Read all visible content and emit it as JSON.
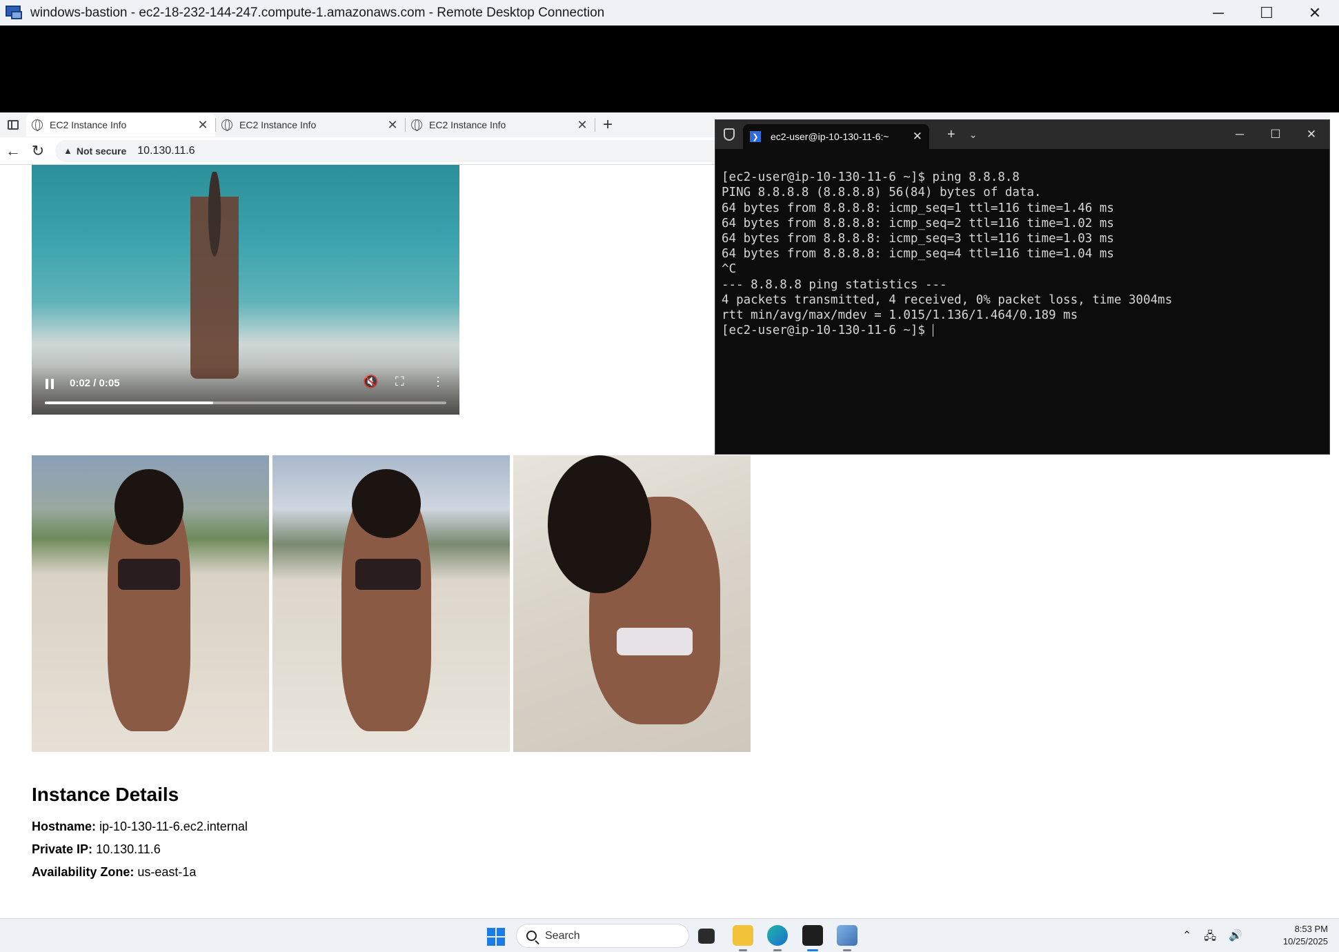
{
  "rdp": {
    "title": "windows-bastion - ec2-18-232-144-247.compute-1.amazonaws.com - Remote Desktop Connection",
    "minimize": "─",
    "maximize": "☐",
    "close": "✕"
  },
  "browser": {
    "tabs": [
      {
        "label": "EC2 Instance Info",
        "close": "✕"
      },
      {
        "label": "EC2 Instance Info",
        "close": "✕"
      },
      {
        "label": "EC2 Instance Info",
        "close": "✕"
      }
    ],
    "new_tab": "+",
    "back": "←",
    "reload": "↻",
    "security_icon": "▲",
    "security_text": "Not secure",
    "url": "10.130.11.6"
  },
  "video": {
    "time": "0:02 / 0:05",
    "progress": 0.42,
    "mute_icon": "🔇",
    "fullscreen_icon": "⛶",
    "more_icon": "⋮"
  },
  "details": {
    "heading": "Instance Details",
    "hostname_label": "Hostname:",
    "hostname": "ip-10-130-11-6.ec2.internal",
    "ip_label": "Private IP:",
    "ip": "10.130.11.6",
    "az_label": "Availability Zone:",
    "az": "us-east-1a"
  },
  "terminal": {
    "tab_title": "ec2-user@ip-10-130-11-6:~",
    "tab_close": "✕",
    "new_tab": "+",
    "dropdown": "⌄",
    "minimize": "─",
    "maximize": "☐",
    "close": "✕",
    "lines": [
      "[ec2-user@ip-10-130-11-6 ~]$ ping 8.8.8.8",
      "PING 8.8.8.8 (8.8.8.8) 56(84) bytes of data.",
      "64 bytes from 8.8.8.8: icmp_seq=1 ttl=116 time=1.46 ms",
      "64 bytes from 8.8.8.8: icmp_seq=2 ttl=116 time=1.02 ms",
      "64 bytes from 8.8.8.8: icmp_seq=3 ttl=116 time=1.03 ms",
      "64 bytes from 8.8.8.8: icmp_seq=4 ttl=116 time=1.04 ms",
      "^C",
      "--- 8.8.8.8 ping statistics ---",
      "4 packets transmitted, 4 received, 0% packet loss, time 3004ms",
      "rtt min/avg/max/mdev = 1.015/1.136/1.464/0.189 ms",
      "[ec2-user@ip-10-130-11-6 ~]$ "
    ]
  },
  "taskbar": {
    "search_placeholder": "Search",
    "time": "8:53 PM",
    "date": "10/25/2025",
    "tray_chevron": "⌃",
    "network_icon": "🖧",
    "volume_icon": "🔊"
  }
}
